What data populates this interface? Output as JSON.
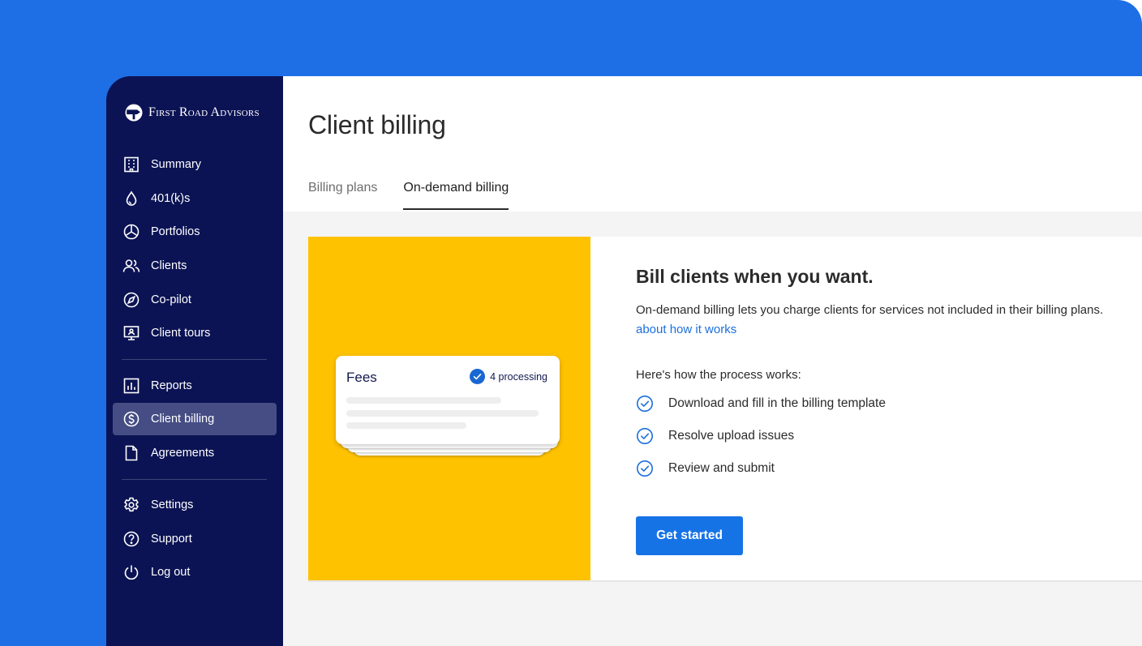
{
  "brand": {
    "name": "First Road Advisors",
    "logo_icon": "road-sign-icon"
  },
  "sidebar": {
    "items": [
      {
        "label": "Summary",
        "icon": "building-icon"
      },
      {
        "label": "401(k)s",
        "icon": "drop-icon"
      },
      {
        "label": "Portfolios",
        "icon": "pie-chart-icon"
      },
      {
        "label": "Clients",
        "icon": "people-icon"
      },
      {
        "label": "Co-pilot",
        "icon": "compass-icon"
      },
      {
        "label": "Client tours",
        "icon": "presentation-icon"
      },
      {
        "label": "Reports",
        "icon": "bar-chart-icon"
      },
      {
        "label": "Client billing",
        "icon": "dollar-icon",
        "active": true
      },
      {
        "label": "Agreements",
        "icon": "document-icon"
      },
      {
        "label": "Settings",
        "icon": "gear-icon"
      },
      {
        "label": "Support",
        "icon": "help-icon"
      },
      {
        "label": "Log out",
        "icon": "power-icon"
      }
    ]
  },
  "main": {
    "title": "Client billing",
    "tabs": [
      {
        "label": "Billing plans",
        "active": false
      },
      {
        "label": "On-demand billing",
        "active": true
      }
    ]
  },
  "illustration": {
    "card_title": "Fees",
    "status": "4 processing"
  },
  "content": {
    "title": "Bill clients when you want.",
    "description": "On-demand billing lets you charge clients for services not included in their billing plans.",
    "link": "about how it works",
    "process_intro": "Here's how the process works:",
    "steps": [
      "Download and fill in the billing template",
      "Resolve upload issues",
      "Review and submit"
    ],
    "cta": "Get started"
  },
  "colors": {
    "backdrop": "#1e6fe6",
    "sidebar": "#0b1354",
    "sidebar_active": "#454d84",
    "illustration": "#ffc200",
    "link": "#1b6fdc",
    "button": "#1673e6"
  }
}
